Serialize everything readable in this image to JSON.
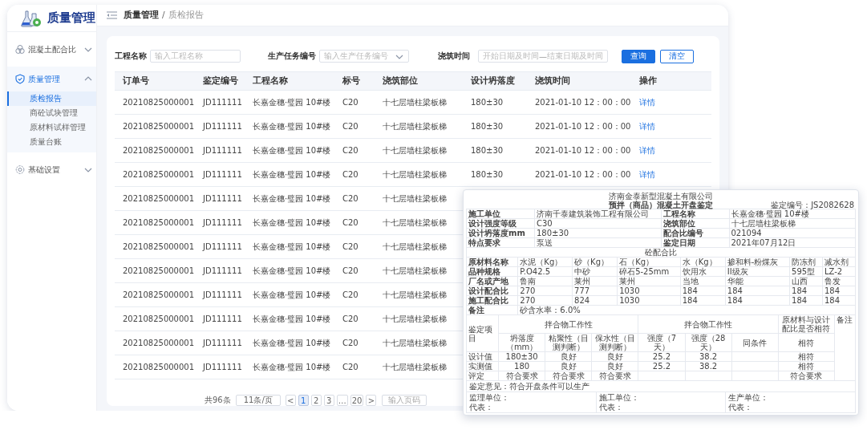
{
  "sidebar": {
    "logo_text": "质量管理",
    "menu": [
      {
        "label": "混凝土配合比",
        "selected": false,
        "expanded": false
      },
      {
        "label": "质量管理",
        "selected": true,
        "expanded": true,
        "children": [
          {
            "label": "质检报告",
            "selected": true
          },
          {
            "label": "商砼试块管理",
            "selected": false
          },
          {
            "label": "原材料试样管理",
            "selected": false
          },
          {
            "label": "质量台账",
            "selected": false
          }
        ]
      },
      {
        "label": "基础设置",
        "selected": false,
        "expanded": false
      }
    ]
  },
  "header": {
    "breadcrumb": [
      {
        "label": "质量管理",
        "current": false
      },
      {
        "label": "质检报告",
        "current": true
      }
    ],
    "separator": "/"
  },
  "filters": [
    {
      "kind": "text",
      "label": "工程名称",
      "placeholder": "输入工程名称"
    },
    {
      "kind": "select",
      "label": "生产任务编号",
      "placeholder": "输入生产任务编号"
    },
    {
      "kind": "daterange",
      "label": "浇筑时间",
      "start_placeholder": "开始日期及时间",
      "separator": "—",
      "end_placeholder": "结束日期及时间"
    }
  ],
  "buttons": [
    {
      "label": "查询",
      "kind": "primary"
    },
    {
      "label": "清空",
      "kind": "secondary"
    }
  ],
  "table": {
    "columns": [
      {
        "label": "订单号",
        "kind": "text"
      },
      {
        "label": "鉴定编号",
        "kind": "text"
      },
      {
        "label": "工程名称",
        "kind": "text"
      },
      {
        "label": "标号",
        "kind": "text"
      },
      {
        "label": "浇筑部位",
        "kind": "text"
      },
      {
        "label": "设计坍落度",
        "kind": "text"
      },
      {
        "label": "浇筑时间",
        "kind": "text"
      },
      {
        "label": "操作",
        "kind": "link"
      }
    ],
    "rows": [
      {
        "cells": [
          "20210825000001",
          "JD111111",
          "长嘉金穗·璧园 10#楼",
          "C20",
          "十七层墙柱梁板梯",
          "180±30",
          "2021-01-10 12：00：00",
          "详情"
        ]
      },
      {
        "cells": [
          "20210825000001",
          "JD111111",
          "长嘉金穗·璧园 10#楼",
          "C20",
          "十七层墙柱梁板梯",
          "180±30",
          "2021-01-10 12：00：00",
          "详情"
        ]
      },
      {
        "cells": [
          "20210825000001",
          "JD111111",
          "长嘉金穗·璧园 10#楼",
          "C20",
          "十七层墙柱梁板梯",
          "180±30",
          "2021-01-10 12：00：00",
          "详情"
        ]
      },
      {
        "cells": [
          "20210825000001",
          "JD111111",
          "长嘉金穗·璧园 10#楼",
          "C20",
          "十七层墙柱梁板梯",
          "180±30",
          "2021-01-10 12：00：00",
          "详情"
        ]
      },
      {
        "cells": [
          "20210825000001",
          "JD111111",
          "长嘉金穗·璧园 10#楼",
          "C20",
          "十七层墙柱梁板梯"
        ]
      },
      {
        "cells": [
          "20210825000001",
          "JD111111",
          "长嘉金穗·璧园 10#楼",
          "C20",
          "十七层墙柱梁板梯"
        ]
      },
      {
        "cells": [
          "20210825000001",
          "JD111111",
          "长嘉金穗·璧园 10#楼",
          "C20",
          "十七层墙柱梁板梯"
        ]
      },
      {
        "cells": [
          "20210825000001",
          "JD111111",
          "长嘉金穗·璧园 10#楼",
          "C20",
          "十七层墙柱梁板梯"
        ]
      },
      {
        "cells": [
          "20210825000001",
          "JD111111",
          "长嘉金穗·璧园 10#楼",
          "C20",
          "十七层墙柱梁板梯"
        ]
      },
      {
        "cells": [
          "20210825000001",
          "JD111111",
          "长嘉金穗·璧园 10#楼",
          "C20",
          "十七层墙柱梁板梯"
        ]
      },
      {
        "cells": [
          "20210825000001",
          "JD111111",
          "长嘉金穗·璧园 10#楼",
          "C20",
          "十七层墙柱梁板梯"
        ]
      },
      {
        "cells": [
          "20210825000001",
          "JD111111",
          "长嘉金穗·璧园 10#楼",
          "C20",
          "十七层墙柱梁板梯"
        ]
      }
    ]
  },
  "pagination": {
    "total": "共96条",
    "page_size": "11条/页",
    "prev": "<",
    "pages": [
      {
        "label": "1",
        "selected": true
      },
      {
        "label": "2",
        "selected": false
      },
      {
        "label": "3",
        "selected": false
      },
      {
        "label": "…",
        "selected": false
      },
      {
        "label": "20",
        "selected": false
      }
    ],
    "next": ">",
    "jump_placeholder": "输入页码"
  },
  "document": {
    "company": "济南金泰新型混凝土有限公司",
    "title": "预拌（商品）混凝土开盘鉴定",
    "code": "鉴定编号：JS2082628",
    "info_rows": [
      [
        "施工单位",
        "济南千泰建筑装饰工程有限公司",
        "工程名称",
        "长嘉金穗·璧园 10#楼"
      ],
      [
        "设计强度等级",
        "C30",
        "浇筑部位",
        "十七层墙柱梁板梯"
      ],
      [
        "设计坍落度mm",
        "180±30",
        "配合比编号",
        "021094"
      ],
      [
        "特点要求",
        "泵送",
        "鉴定日期",
        "2021年07月12日"
      ]
    ],
    "section_title": "砼配合比",
    "materials": [
      [
        "原材料名称",
        "水泥（Kg）",
        "砂（Kg）",
        "石（Kg）",
        "水（Kg）",
        "掺和料-粉煤灰",
        "防冻剂",
        "减水剂"
      ],
      [
        "品种规格",
        "P.O42.5",
        "中砂",
        "碎石5-25mm",
        "饮用水",
        "II级灰",
        "595型",
        "LZ-2"
      ],
      [
        "厂名或产地",
        "鲁南",
        "莱州",
        "莱州",
        "当地",
        "华能",
        "山西",
        "鲁发"
      ],
      [
        "设计配合比",
        "270",
        "777",
        "1030",
        "184",
        "184",
        "184",
        "184"
      ],
      [
        "施工配合比",
        "270",
        "824",
        "1030",
        "184",
        "184",
        "184",
        "184"
      ]
    ],
    "note": {
      "label": "备注",
      "text": "砂含水率：6.0%"
    },
    "appraisal": {
      "item_label": "鉴定项目",
      "groups": [
        "拌合物工作性",
        "拌合物工作性",
        "原材料与设计配比是否相符",
        "备注"
      ],
      "subheader": [
        "坍落度（mm）",
        "粘聚性（目测判断）",
        "保水性（目测判断）",
        "强度（7天）",
        "强度（28天）",
        "同条件",
        "相符"
      ],
      "rows": [
        [
          "设计值",
          "180±30",
          "良好",
          "良好",
          "25.2",
          "38.2",
          null,
          "相符"
        ],
        [
          "实测值",
          "180",
          "良好",
          "良好",
          "25.2",
          "38.2",
          null,
          "相符"
        ],
        [
          "评定",
          "符合要求",
          "符合要求",
          "符合要求",
          null,
          null,
          null,
          "符合要求"
        ]
      ]
    },
    "opinion": "鉴定意见：符合开盘条件可以生产",
    "signatures": [
      {
        "unit": "监理单位：",
        "rep": "代表："
      },
      {
        "unit": "施工单位：",
        "rep": "代表："
      },
      {
        "unit": "生产单位：",
        "rep": "代表："
      }
    ]
  }
}
